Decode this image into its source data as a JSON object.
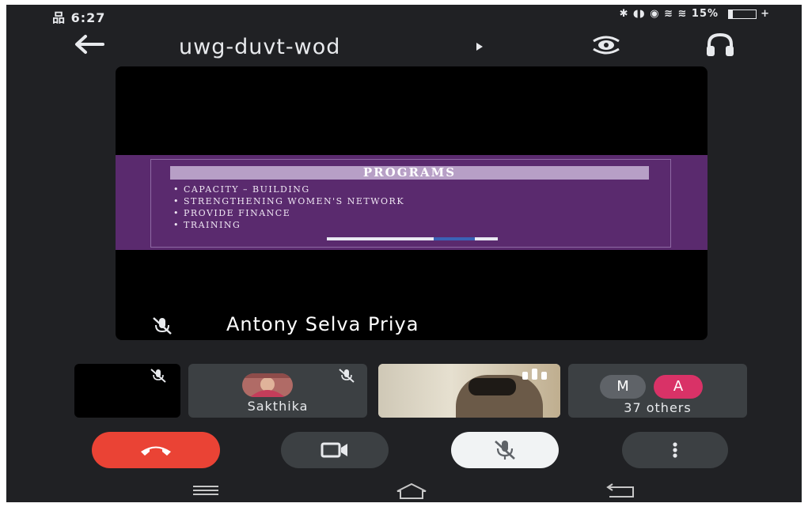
{
  "status_bar": {
    "left": "品 6:27",
    "right": "✱ ◖◗ ◉ ≋ ≋ 15%",
    "battery_level": 0.15,
    "battery_suffix": "+"
  },
  "header": {
    "meeting_code": "uwg-duvt-wod",
    "icons": [
      "back-arrow-icon",
      "caret-right-icon",
      "switch-camera-icon",
      "headphones-icon"
    ]
  },
  "presentation": {
    "speaker_name": "Antony Selva Priya",
    "speaker_muted": true,
    "slide_title": "PROGRAMS",
    "slide_items": [
      "• CAPACITY – BUILDING",
      "• STRENGTHENING WOMEN'S NETWORK",
      "• PROVIDE FINANCE",
      "• TRAINING"
    ]
  },
  "participants": {
    "tile2_name": "Sakthika",
    "others_label": "37 others",
    "avatar_m": "M",
    "avatar_a": "A"
  },
  "controls": {
    "icons": [
      "end-call-icon",
      "camera-icon",
      "mic-off-icon",
      "more-vert-icon"
    ]
  },
  "colors": {
    "background": "#202124",
    "end_call": "#ea4335",
    "slide_purple": "#5a2a6e",
    "avatar_a": "#d93267"
  }
}
